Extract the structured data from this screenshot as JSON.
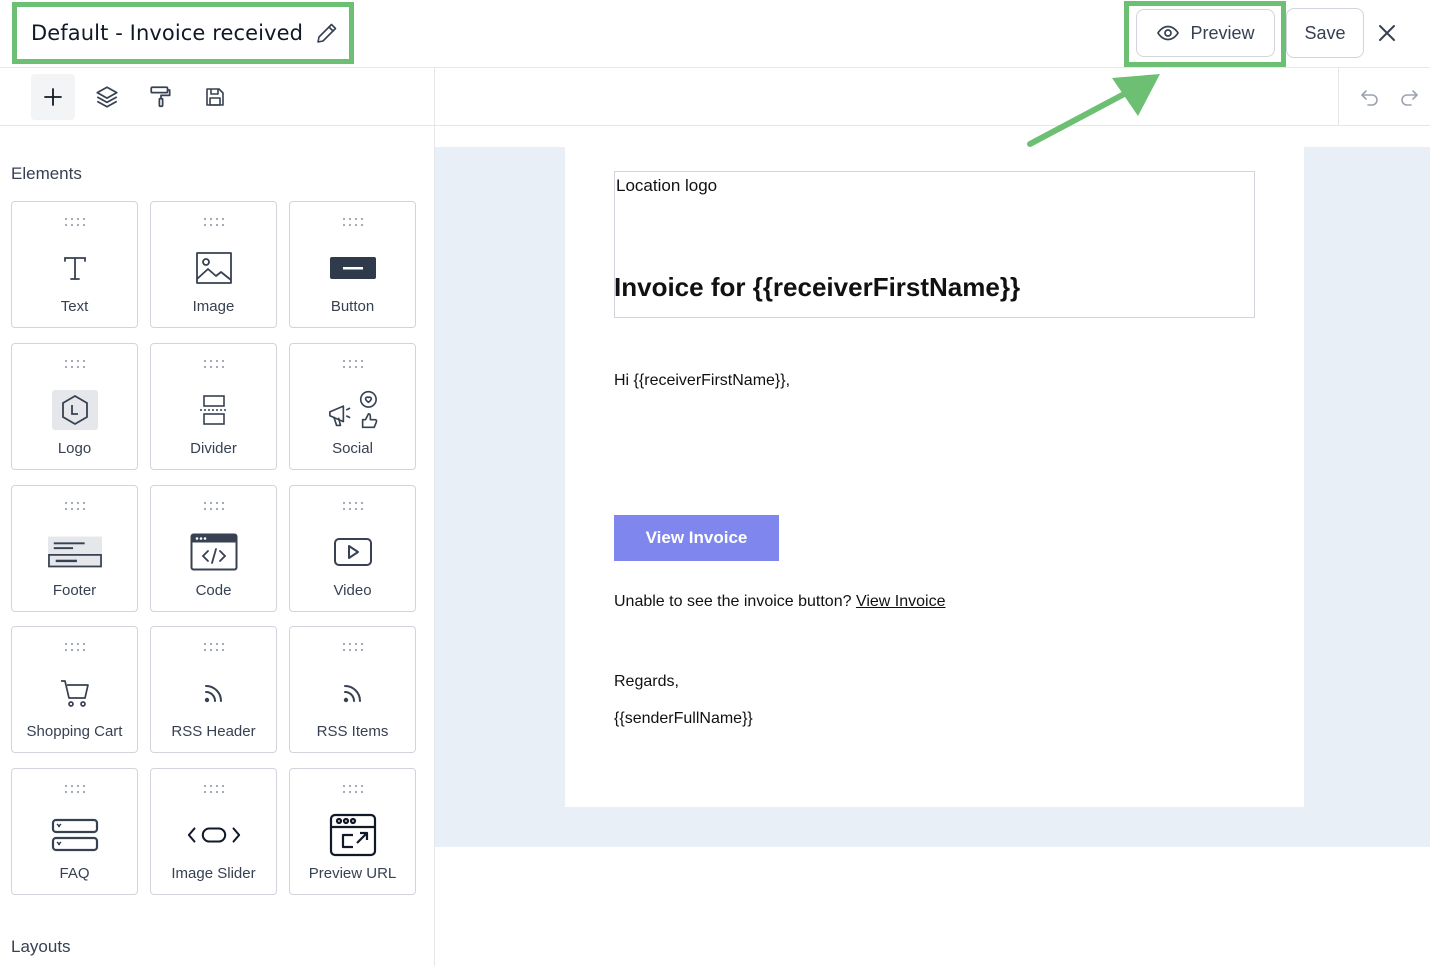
{
  "header": {
    "title": "Default - Invoice received",
    "preview_label": "Preview",
    "save_label": "Save"
  },
  "sidebar": {
    "elements_heading": "Elements",
    "layouts_heading": "Layouts",
    "elements": [
      {
        "label": "Text",
        "icon": "text-icon"
      },
      {
        "label": "Image",
        "icon": "image-icon"
      },
      {
        "label": "Button",
        "icon": "button-icon"
      },
      {
        "label": "Logo",
        "icon": "logo-icon"
      },
      {
        "label": "Divider",
        "icon": "divider-icon"
      },
      {
        "label": "Social",
        "icon": "social-icon"
      },
      {
        "label": "Footer",
        "icon": "footer-icon"
      },
      {
        "label": "Code",
        "icon": "code-icon"
      },
      {
        "label": "Video",
        "icon": "video-icon"
      },
      {
        "label": "Shopping Cart",
        "icon": "cart-icon"
      },
      {
        "label": "RSS Header",
        "icon": "rss-icon"
      },
      {
        "label": "RSS Items",
        "icon": "rss-icon"
      },
      {
        "label": "FAQ",
        "icon": "faq-icon"
      },
      {
        "label": "Image Slider",
        "icon": "slider-icon"
      },
      {
        "label": "Preview URL",
        "icon": "preview-url-icon"
      }
    ]
  },
  "email": {
    "logo_placeholder": "Location logo",
    "title": "Invoice for {{receiverFirstName}}",
    "greeting": "Hi {{receiverFirstName}},",
    "button_label": "View Invoice",
    "fallback_text": "Unable to see the invoice button? ",
    "fallback_link": "View Invoice",
    "regards": "Regards,",
    "sender": "{{senderFullName}}"
  },
  "colors": {
    "highlight": "#6cbf73",
    "button": "#7f86ee",
    "canvas": "#e9eff6"
  }
}
